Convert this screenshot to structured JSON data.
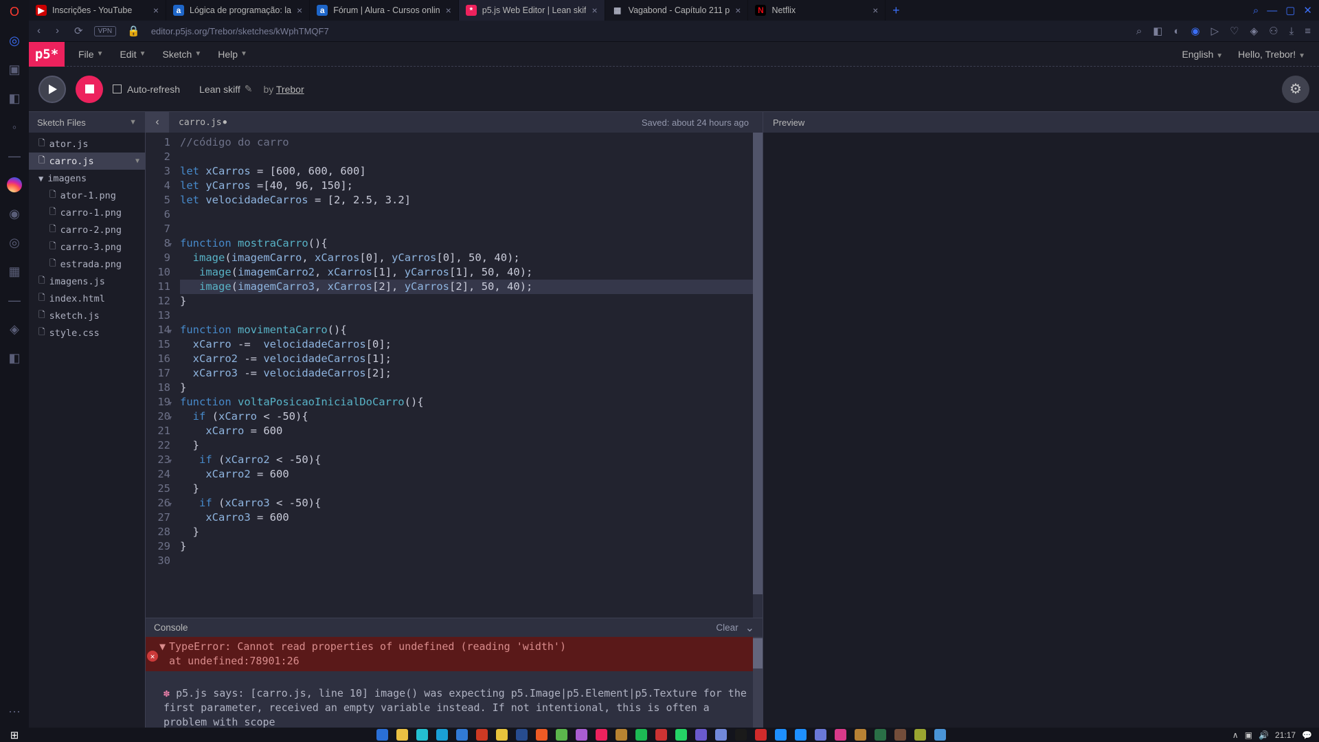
{
  "operaIcons": [
    "◎",
    "◇",
    "▣",
    "◧",
    "◦",
    "—",
    "★",
    "◉",
    "◎",
    "◎",
    "▦",
    "—",
    "◧",
    "◈",
    "✿"
  ],
  "tabs": [
    {
      "fav": "▶",
      "favStyle": "background:#cc0000;color:#fff",
      "label": "Inscrições - YouTube"
    },
    {
      "fav": "a",
      "favStyle": "background:#1e66c9;color:#fff",
      "label": "Lógica de programação: la"
    },
    {
      "fav": "a",
      "favStyle": "background:#1e66c9;color:#fff",
      "label": "Fórum | Alura - Cursos onlin"
    },
    {
      "fav": "*",
      "favStyle": "background:#ed225d;color:#fff",
      "label": "p5.js Web Editor | Lean skif"
    },
    {
      "fav": "▦",
      "favStyle": "color:#aeb1c1",
      "label": "Vagabond - Capítulo 211 p"
    },
    {
      "fav": "N",
      "favStyle": "background:#000;color:#e50914;font-weight:bold",
      "label": "Netflix"
    }
  ],
  "activeTab": 3,
  "url": "editor.p5js.org/Trebor/sketches/kWphTMQF7",
  "vpn": "VPN",
  "p5": {
    "logo": "p5*",
    "menu": [
      "File",
      "Edit",
      "Sketch",
      "Help"
    ],
    "language": "English",
    "hello": "Hello, Trebor!",
    "autoRefresh": "Auto-refresh",
    "sketchName": "Lean skiff",
    "byLabel": "by",
    "author": "Trebor",
    "sidebar": {
      "title": "Sketch Files"
    },
    "files": [
      {
        "name": "ator.js",
        "type": "file"
      },
      {
        "name": "carro.js",
        "type": "file",
        "active": true,
        "arrow": true
      },
      {
        "name": "imagens",
        "type": "dir"
      },
      {
        "name": "ator-1.png",
        "type": "file",
        "child": true
      },
      {
        "name": "carro-1.png",
        "type": "file",
        "child": true
      },
      {
        "name": "carro-2.png",
        "type": "file",
        "child": true
      },
      {
        "name": "carro-3.png",
        "type": "file",
        "child": true
      },
      {
        "name": "estrada.png",
        "type": "file",
        "child": true
      },
      {
        "name": "imagens.js",
        "type": "file"
      },
      {
        "name": "index.html",
        "type": "file"
      },
      {
        "name": "sketch.js",
        "type": "file"
      },
      {
        "name": "style.css",
        "type": "file"
      }
    ],
    "openFile": "carro.js",
    "dirty": "●",
    "saved": "Saved: about 24 hours ago",
    "previewLabel": "Preview",
    "code": [
      [
        {
          "c": "c-cm",
          "t": "//código do carro"
        }
      ],
      [],
      [
        {
          "c": "c-kw",
          "t": "let "
        },
        {
          "c": "c-var",
          "t": "xCarros"
        },
        {
          "t": " = ["
        },
        {
          "c": "c-num",
          "t": "600"
        },
        {
          "t": ", "
        },
        {
          "c": "c-num",
          "t": "600"
        },
        {
          "t": ", "
        },
        {
          "c": "c-num",
          "t": "600"
        },
        {
          "t": "]"
        }
      ],
      [
        {
          "c": "c-kw",
          "t": "let "
        },
        {
          "c": "c-var",
          "t": "yCarros"
        },
        {
          "t": " =["
        },
        {
          "c": "c-num",
          "t": "40"
        },
        {
          "t": ", "
        },
        {
          "c": "c-num",
          "t": "96"
        },
        {
          "t": ", "
        },
        {
          "c": "c-num",
          "t": "150"
        },
        {
          "t": "];"
        }
      ],
      [
        {
          "c": "c-kw",
          "t": "let "
        },
        {
          "c": "c-var",
          "t": "velocidadeCarros"
        },
        {
          "t": " = ["
        },
        {
          "c": "c-num",
          "t": "2"
        },
        {
          "t": ", "
        },
        {
          "c": "c-num",
          "t": "2.5"
        },
        {
          "t": ", "
        },
        {
          "c": "c-num",
          "t": "3.2"
        },
        {
          "t": "]"
        }
      ],
      [],
      [],
      [
        {
          "c": "c-kw",
          "t": "function "
        },
        {
          "c": "c-fn",
          "t": "mostraCarro"
        },
        {
          "t": "(){"
        }
      ],
      [
        {
          "t": "  "
        },
        {
          "c": "c-fn",
          "t": "image"
        },
        {
          "t": "("
        },
        {
          "c": "c-var",
          "t": "imagemCarro"
        },
        {
          "t": ", "
        },
        {
          "c": "c-var",
          "t": "xCarros"
        },
        {
          "t": "["
        },
        {
          "c": "c-num",
          "t": "0"
        },
        {
          "t": "], "
        },
        {
          "c": "c-var",
          "t": "yCarros"
        },
        {
          "t": "["
        },
        {
          "c": "c-num",
          "t": "0"
        },
        {
          "t": "], "
        },
        {
          "c": "c-num",
          "t": "50"
        },
        {
          "t": ", "
        },
        {
          "c": "c-num",
          "t": "40"
        },
        {
          "t": ");"
        }
      ],
      [
        {
          "t": "   "
        },
        {
          "c": "c-fn",
          "t": "image"
        },
        {
          "t": "("
        },
        {
          "c": "c-var",
          "t": "imagemCarro2"
        },
        {
          "t": ", "
        },
        {
          "c": "c-var",
          "t": "xCarros"
        },
        {
          "t": "["
        },
        {
          "c": "c-num",
          "t": "1"
        },
        {
          "t": "], "
        },
        {
          "c": "c-var",
          "t": "yCarros"
        },
        {
          "t": "["
        },
        {
          "c": "c-num",
          "t": "1"
        },
        {
          "t": "], "
        },
        {
          "c": "c-num",
          "t": "50"
        },
        {
          "t": ", "
        },
        {
          "c": "c-num",
          "t": "40"
        },
        {
          "t": ");"
        }
      ],
      [
        {
          "t": "   "
        },
        {
          "c": "c-fn",
          "t": "image"
        },
        {
          "t": "("
        },
        {
          "c": "c-var",
          "t": "imagemCarro3"
        },
        {
          "t": ", "
        },
        {
          "c": "c-var",
          "t": "xCarros"
        },
        {
          "t": "["
        },
        {
          "c": "c-num",
          "t": "2"
        },
        {
          "t": "], "
        },
        {
          "c": "c-var",
          "t": "yCarros"
        },
        {
          "t": "["
        },
        {
          "c": "c-num",
          "t": "2"
        },
        {
          "t": "], "
        },
        {
          "c": "c-num",
          "t": "50"
        },
        {
          "t": ", "
        },
        {
          "c": "c-num",
          "t": "40"
        },
        {
          "t": ");"
        }
      ],
      [
        {
          "t": "}"
        }
      ],
      [],
      [
        {
          "c": "c-kw",
          "t": "function "
        },
        {
          "c": "c-fn",
          "t": "movimentaCarro"
        },
        {
          "t": "(){"
        }
      ],
      [
        {
          "t": "  "
        },
        {
          "c": "c-var",
          "t": "xCarro"
        },
        {
          "t": " -=  "
        },
        {
          "c": "c-var",
          "t": "velocidadeCarros"
        },
        {
          "t": "["
        },
        {
          "c": "c-num",
          "t": "0"
        },
        {
          "t": "];"
        }
      ],
      [
        {
          "t": "  "
        },
        {
          "c": "c-var",
          "t": "xCarro2"
        },
        {
          "t": " -= "
        },
        {
          "c": "c-var",
          "t": "velocidadeCarros"
        },
        {
          "t": "["
        },
        {
          "c": "c-num",
          "t": "1"
        },
        {
          "t": "];"
        }
      ],
      [
        {
          "t": "  "
        },
        {
          "c": "c-var",
          "t": "xCarro3"
        },
        {
          "t": " -= "
        },
        {
          "c": "c-var",
          "t": "velocidadeCarros"
        },
        {
          "t": "["
        },
        {
          "c": "c-num",
          "t": "2"
        },
        {
          "t": "];"
        }
      ],
      [
        {
          "t": "}"
        }
      ],
      [
        {
          "c": "c-kw",
          "t": "function "
        },
        {
          "c": "c-fn",
          "t": "voltaPosicaoInicialDoCarro"
        },
        {
          "t": "(){"
        }
      ],
      [
        {
          "t": "  "
        },
        {
          "c": "c-kw",
          "t": "if"
        },
        {
          "t": " ("
        },
        {
          "c": "c-var",
          "t": "xCarro"
        },
        {
          "t": " < -"
        },
        {
          "c": "c-num",
          "t": "50"
        },
        {
          "t": "){"
        }
      ],
      [
        {
          "t": "    "
        },
        {
          "c": "c-var",
          "t": "xCarro"
        },
        {
          "t": " = "
        },
        {
          "c": "c-num",
          "t": "600"
        }
      ],
      [
        {
          "t": "  }"
        }
      ],
      [
        {
          "t": "   "
        },
        {
          "c": "c-kw",
          "t": "if"
        },
        {
          "t": " ("
        },
        {
          "c": "c-var",
          "t": "xCarro2"
        },
        {
          "t": " < -"
        },
        {
          "c": "c-num",
          "t": "50"
        },
        {
          "t": "){"
        }
      ],
      [
        {
          "t": "    "
        },
        {
          "c": "c-var",
          "t": "xCarro2"
        },
        {
          "t": " = "
        },
        {
          "c": "c-num",
          "t": "600"
        }
      ],
      [
        {
          "t": "  }"
        }
      ],
      [
        {
          "t": "   "
        },
        {
          "c": "c-kw",
          "t": "if"
        },
        {
          "t": " ("
        },
        {
          "c": "c-var",
          "t": "xCarro3"
        },
        {
          "t": " < -"
        },
        {
          "c": "c-num",
          "t": "50"
        },
        {
          "t": "){"
        }
      ],
      [
        {
          "t": "    "
        },
        {
          "c": "c-var",
          "t": "xCarro3"
        },
        {
          "t": " = "
        },
        {
          "c": "c-num",
          "t": "600"
        }
      ],
      [
        {
          "t": "  }"
        }
      ],
      [
        {
          "t": "}"
        }
      ],
      []
    ],
    "foldLines": [
      8,
      14,
      19,
      20,
      23,
      26
    ],
    "currentLine": 11,
    "console": {
      "title": "Console",
      "clear": "Clear",
      "error": "TypeError: Cannot read properties of undefined (reading 'width')",
      "errorAt": "    at undefined:78901:26",
      "msg": "p5.js says: [carro.js, line 10] image() was expecting p5.Image|p5.Element|p5.Texture for the first parameter, received an empty variable instead. If not intentional, this is often a problem with scope"
    }
  },
  "taskbar": {
    "time": "21:17",
    "tray": [
      "∧",
      "∿",
      "☁",
      "◧",
      "↗",
      "🔊"
    ],
    "apps": [
      "#2a6fd6",
      "#eac043",
      "#24c0d1",
      "#1aa0d6",
      "#317ad5",
      "#cc3a23",
      "#e7c33c",
      "#274c8f",
      "#ed5b25",
      "#5bb54c",
      "#a95dd1",
      "#ed225d",
      "#b88331",
      "#1db954",
      "#cc3333",
      "#25d366",
      "#6a5acd",
      "#7289da",
      "#1a1a1a",
      "#d12b2b",
      "#1e90ff",
      "#1e90ff",
      "#6a78d8",
      "#d93a8a",
      "#b88234",
      "#2a6f46",
      "#734d3a",
      "#9aa530",
      "#4a94d6"
    ]
  }
}
